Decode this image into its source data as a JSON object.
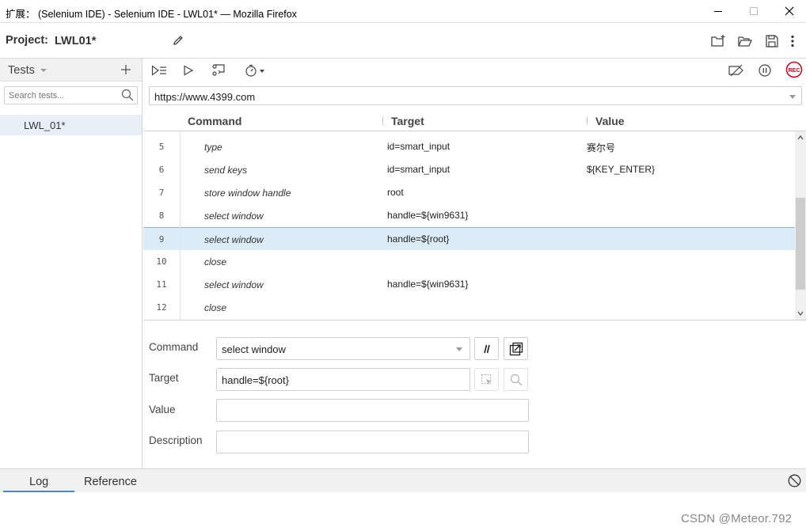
{
  "window": {
    "title": "扩展： (Selenium IDE) - Selenium IDE - LWL01* — Mozilla Firefox"
  },
  "project": {
    "label": "Project:",
    "name": "LWL01*"
  },
  "sidebar": {
    "title": "Tests",
    "search_placeholder": "Search tests...",
    "tests": [
      {
        "name": "LWL_01*",
        "selected": true
      }
    ]
  },
  "url": {
    "value": "https://www.4399.com"
  },
  "grid": {
    "headers": {
      "command": "Command",
      "target": "Target",
      "value": "Value"
    },
    "rows": [
      {
        "num": "5",
        "command": "type",
        "target": "id=smart_input",
        "value": "赛尔号"
      },
      {
        "num": "6",
        "command": "send keys",
        "target": "id=smart_input",
        "value": "${KEY_ENTER}"
      },
      {
        "num": "7",
        "command": "store window handle",
        "target": "root",
        "value": ""
      },
      {
        "num": "8",
        "command": "select window",
        "target": "handle=${win9631}",
        "value": ""
      },
      {
        "num": "9",
        "command": "select window",
        "target": "handle=${root}",
        "value": "",
        "selected": true
      },
      {
        "num": "10",
        "command": "close",
        "target": "",
        "value": ""
      },
      {
        "num": "11",
        "command": "select window",
        "target": "handle=${win9631}",
        "value": ""
      },
      {
        "num": "12",
        "command": "close",
        "target": "",
        "value": ""
      }
    ]
  },
  "editor": {
    "command_label": "Command",
    "command_value": "select window",
    "target_label": "Target",
    "target_value": "handle=${root}",
    "value_label": "Value",
    "value_value": "",
    "description_label": "Description",
    "description_value": ""
  },
  "console": {
    "tabs": [
      "Log",
      "Reference"
    ],
    "active_tab": "Log"
  },
  "toolbar": {
    "record_label": "REC"
  },
  "watermark": "CSDN @Meteor.792",
  "colors": {
    "selection": "#dcebf8",
    "record_red": "#d0021b",
    "accent_blue": "#3a8ad6"
  }
}
